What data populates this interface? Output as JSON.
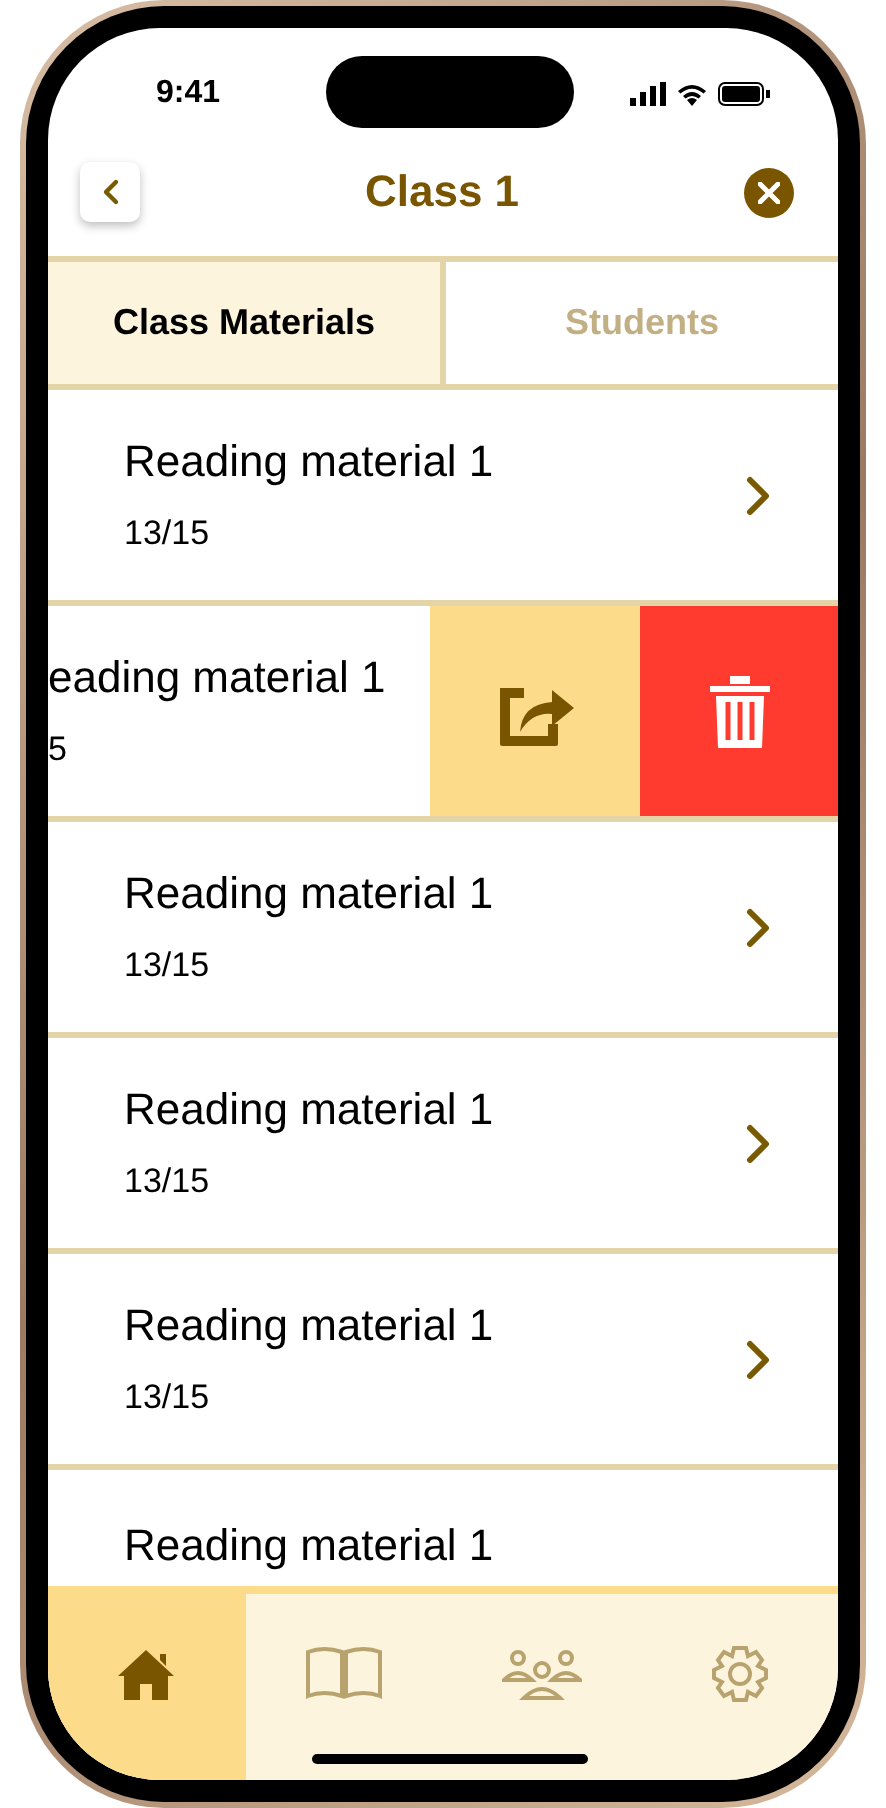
{
  "status_bar": {
    "time": "9:41"
  },
  "header": {
    "title": "Class 1"
  },
  "tabs": [
    {
      "label": "Class Materials",
      "selected": true
    },
    {
      "label": "Students",
      "selected": false
    }
  ],
  "materials": [
    {
      "kind": "normal",
      "title": "Reading material 1",
      "subtitle": "13/15"
    },
    {
      "kind": "swiped",
      "title": "eading material 1",
      "subtitle": "5"
    },
    {
      "kind": "normal",
      "title": "Reading material 1",
      "subtitle": "13/15"
    },
    {
      "kind": "normal",
      "title": "Reading material 1",
      "subtitle": "13/15"
    },
    {
      "kind": "normal",
      "title": "Reading material 1",
      "subtitle": "13/15"
    },
    {
      "kind": "partial",
      "title": "Reading material 1"
    }
  ],
  "bottom_nav": [
    {
      "kind": "home",
      "selected": true
    },
    {
      "kind": "book",
      "selected": false
    },
    {
      "kind": "people",
      "selected": false
    },
    {
      "kind": "settings",
      "selected": false
    }
  ]
}
